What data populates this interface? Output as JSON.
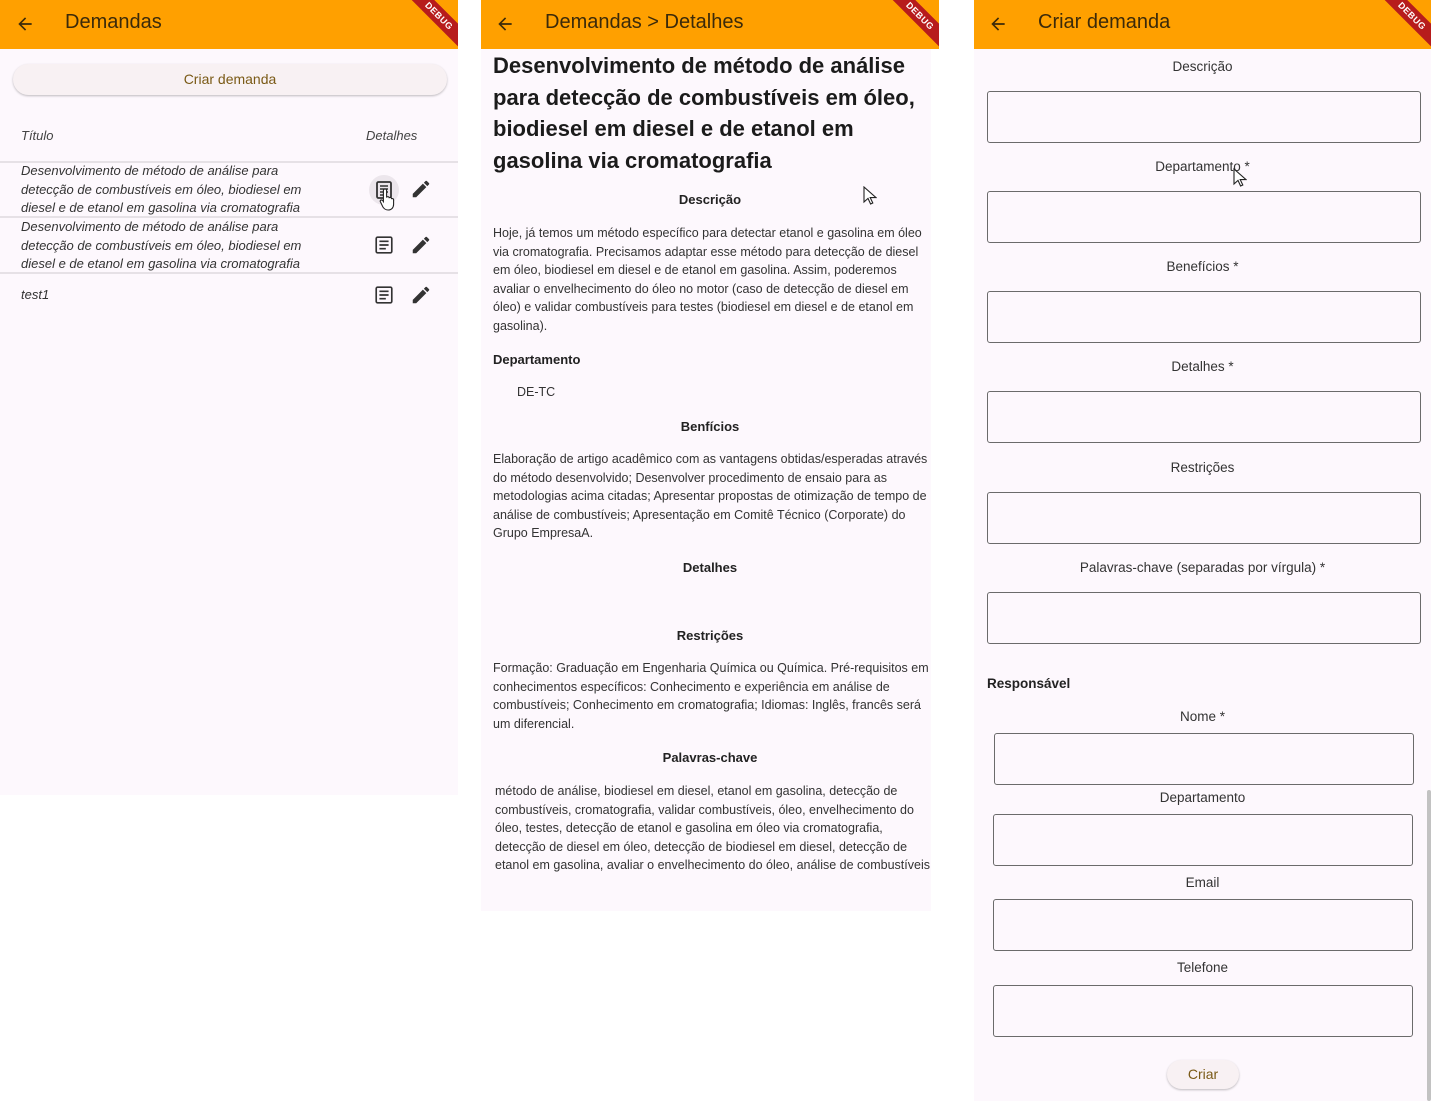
{
  "colors": {
    "appbar": "#ffa000",
    "appbar_text": "#3b2a0a",
    "body_bg": "#fdf8fd",
    "banner": "#b71c1c",
    "button_bg": "#f8f1f3",
    "button_text": "#7a5a16",
    "divider": "#e6e1e6",
    "scrollbar": "#c2c2c2"
  },
  "debug_banner": "DEBUG",
  "list_screen": {
    "title": "Demandas",
    "back_icon": "arrow-back-icon",
    "create_button": "Criar demanda",
    "columns": {
      "title": "Título",
      "details": "Detalhes"
    },
    "rows": [
      {
        "text": "Desenvolvimento de método de análise para detecção de combustíveis em óleo, biodiesel em diesel e de etanol em gasolina via cromatografia",
        "detail_icon": "article-icon",
        "edit_icon": "pencil-icon"
      },
      {
        "text": "Desenvolvimento de método de análise para detecção de combustíveis em óleo, biodiesel em diesel e de etanol em gasolina via cromatografia",
        "detail_icon": "article-icon",
        "edit_icon": "pencil-icon"
      },
      {
        "text": "test1",
        "detail_icon": "article-icon",
        "edit_icon": "pencil-icon"
      }
    ]
  },
  "detail_screen": {
    "title": "Demandas > Detalhes",
    "heading": "Desenvolvimento de método de análise para detecção de combustíveis em óleo, biodiesel em diesel e de etanol em gasolina via cromatografia",
    "descricao_label": "Descrição",
    "descricao_text": "Hoje, já temos um método específico para detectar etanol e gasolina em óleo via cromatografia. Precisamos adaptar esse método para detecção de diesel em óleo, biodiesel em diesel e de etanol em gasolina. Assim, poderemos avaliar o envelhecimento do óleo no motor (caso de detecção de diesel em óleo) e validar combustíveis para testes (biodiesel em diesel e de etanol em gasolina).",
    "departamento_label": "Departamento",
    "departamento_value": "DE-TC",
    "beneficios_label": "Benfícios",
    "beneficios_text": "Elaboração de artigo acadêmico com as vantagens obtidas/esperadas através do método desenvolvido; Desenvolver procedimento de ensaio para as metodologias acima citadas; Apresentar propostas de otimização de tempo de análise de combustíveis; Apresentação em Comitê Técnico (Corporate) do Grupo EmpresaA.",
    "detalhes_label": "Detalhes",
    "restricoes_label": "Restrições",
    "restricoes_text": "Formação: Graduação em Engenharia Química ou Química. Pré-requisitos em conhecimentos específicos: Conhecimento e experiência em análise de combustíveis; Conhecimento em cromatografia; Idiomas: Inglês, francês será um diferencial.",
    "palavras_label": "Palavras-chave",
    "palavras_text": "método de análise, biodiesel em diesel, etanol em gasolina, detecção de combustíveis, cromatografia, validar combustíveis, óleo, envelhecimento do óleo, testes, detecção de etanol e gasolina em óleo via cromatografia, detecção de diesel em óleo, detecção de biodiesel em diesel, detecção de etanol em gasolina, avaliar o envelhecimento do óleo, análise de combustíveis"
  },
  "form_screen": {
    "title": "Criar demanda",
    "fields": {
      "descricao": "Descrição",
      "departamento": "Departamento *",
      "beneficios": "Benefícios *",
      "detalhes": "Detalhes *",
      "restricoes": "Restrições",
      "palavras": "Palavras-chave (separadas por vírgula) *"
    },
    "responsavel_label": "Responsável",
    "responsavel_fields": {
      "nome": "Nome *",
      "departamento": "Departamento",
      "email": "Email",
      "telefone": "Telefone"
    },
    "submit_button": "Criar"
  }
}
